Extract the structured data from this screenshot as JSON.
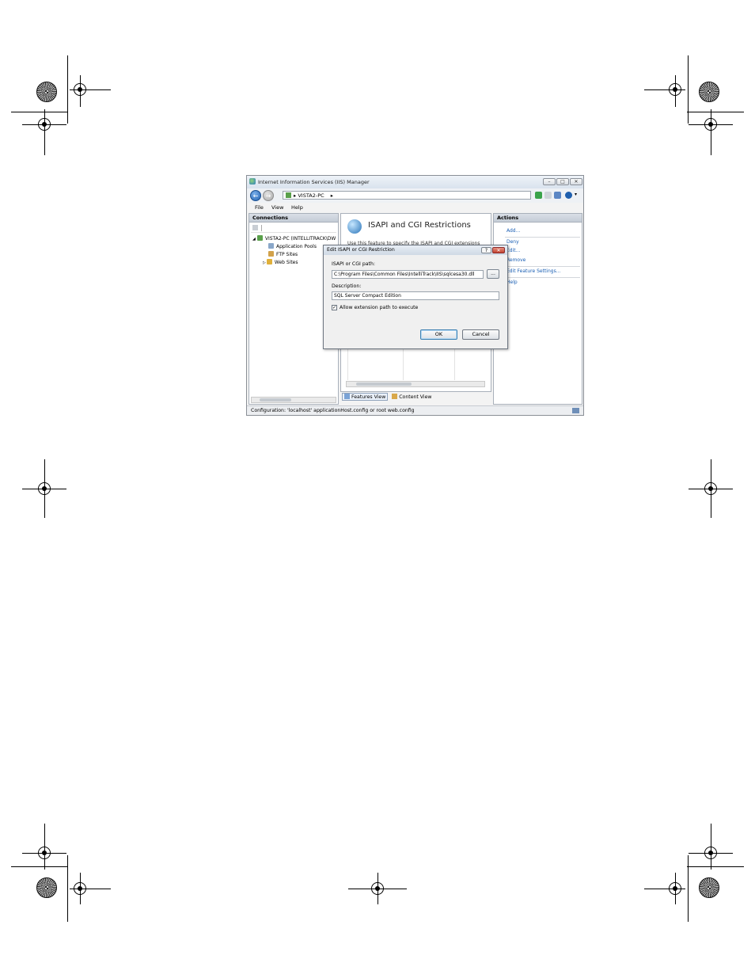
{
  "window": {
    "title": "Internet Information Services (IIS) Manager",
    "minimize": "–",
    "maximize": "□",
    "close": "✕"
  },
  "navigation": {
    "back": "←",
    "forward": "→",
    "address": "VISTA2-PC",
    "separator": "▸"
  },
  "menu": {
    "file": "File",
    "view": "View",
    "help": "Help"
  },
  "connections": {
    "header": "Connections",
    "tree": [
      {
        "label": "VISTA2-PC (INTELLITRACK\\DW",
        "expander": "◢"
      },
      {
        "label": "Application Pools"
      },
      {
        "label": "FTP Sites"
      },
      {
        "label": "Web Sites",
        "expander": "▷"
      }
    ]
  },
  "feature": {
    "title": "ISAPI and CGI Restrictions",
    "description": "Use this feature to specify the ISAPI and CGI extensions"
  },
  "views": {
    "features": "Features View",
    "content": "Content View"
  },
  "actions": {
    "header": "Actions",
    "add": "Add...",
    "deny": "Deny",
    "edit": "Edit...",
    "remove": "Remove",
    "edit_feature_settings": "Edit Feature Settings...",
    "help": "Help"
  },
  "dialog": {
    "title": "Edit ISAPI or CGI Restriction",
    "help": "?",
    "close": "✕",
    "path_label": "ISAPI or CGI path:",
    "path_value": "C:\\Program Files\\Common Files\\IntelliTrack\\IIS\\sqlcesa30.dll",
    "browse": "...",
    "description_label": "Description:",
    "description_value": "SQL Server Compact Edition",
    "checkbox_label": "Allow extension path to execute",
    "checkbox_checked": true,
    "checkmark": "✓",
    "ok": "OK",
    "cancel": "Cancel"
  },
  "status": {
    "text": "Configuration: 'localhost' applicationHost.config or root web.config"
  },
  "colors": {
    "accent": "#1a5fb4",
    "titlebar": "#d9e3ee"
  }
}
